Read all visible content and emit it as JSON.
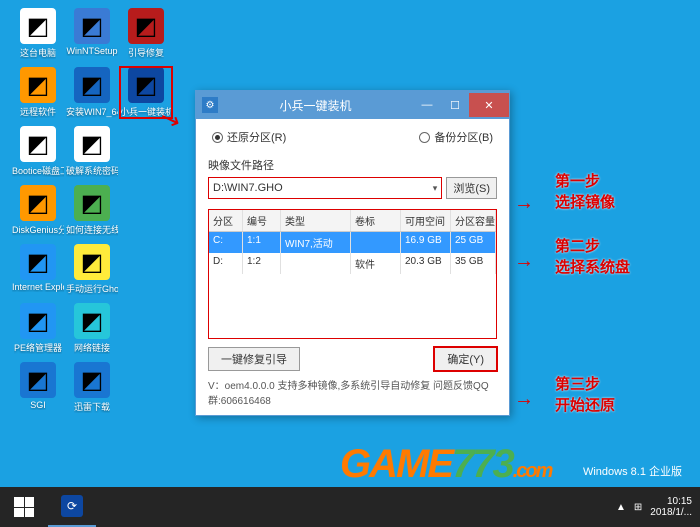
{
  "desktop": {
    "icons": [
      [
        {
          "label": "这台电脑",
          "name": "this-pc",
          "bg": "#fff"
        },
        {
          "label": "WinNTSetup",
          "name": "win-nt-setup",
          "bg": "#3a7bd5"
        },
        {
          "label": "引导修复",
          "name": "boot-repair",
          "bg": "#b71c1c"
        }
      ],
      [
        {
          "label": "远程软件",
          "name": "remote-software",
          "bg": "#ff9800"
        },
        {
          "label": "安装WIN7_64...",
          "name": "install-win7",
          "bg": "#1565c0"
        },
        {
          "label": "小兵一键装机",
          "name": "xiaobing-installer",
          "bg": "#0d47a1",
          "highlighted": true
        }
      ],
      [
        {
          "label": "Bootice磁盘工具",
          "name": "bootice",
          "bg": "#fff"
        },
        {
          "label": "破解系统密码",
          "name": "crack-password",
          "bg": "#fff"
        }
      ],
      [
        {
          "label": "DiskGenius分区工具",
          "name": "diskgenius",
          "bg": "#ff9800"
        },
        {
          "label": "如何连接无线网络",
          "name": "wifi-help",
          "bg": "#4caf50"
        }
      ],
      [
        {
          "label": "Internet Explorer",
          "name": "internet-explorer",
          "bg": "#2196f3"
        },
        {
          "label": "手动运行Ghost",
          "name": "ghost-manual",
          "bg": "#ffeb3b"
        }
      ],
      [
        {
          "label": "PE络管理器",
          "name": "pe-network",
          "bg": "#2196f3"
        },
        {
          "label": "网络链接",
          "name": "network-conn",
          "bg": "#26c6da"
        }
      ],
      [
        {
          "label": "SGI",
          "name": "sgi",
          "bg": "#1976d2"
        },
        {
          "label": "迅雷下载",
          "name": "xunlei",
          "bg": "#1976d2"
        }
      ]
    ]
  },
  "dialog": {
    "title": "小兵一键装机",
    "radio_restore": "还原分区(R)",
    "radio_backup": "备份分区(B)",
    "image_path_label": "映像文件路径",
    "image_path_value": "D:\\WIN7.GHO",
    "browse_btn": "浏览(S)",
    "columns": [
      "分区",
      "编号",
      "类型",
      "卷标",
      "可用空间",
      "分区容量"
    ],
    "rows": [
      {
        "part": "C:",
        "num": "1:1",
        "type": "WIN7,活动",
        "vol": "",
        "free": "16.9 GB",
        "size": "25 GB",
        "selected": true
      },
      {
        "part": "D:",
        "num": "1:2",
        "type": "",
        "vol": "软件",
        "free": "20.3 GB",
        "size": "35 GB",
        "selected": false
      }
    ],
    "repair_btn": "一键修复引导",
    "ok_btn": "确定(Y)",
    "footer": "V：oem4.0.0.0        支持多种镜像,多系统引导自动修复 问题反馈QQ群:606616468"
  },
  "annotations": {
    "step1_title": "第一步",
    "step1_sub": "选择镜像",
    "step2_title": "第二步",
    "step2_sub": "选择系统盘",
    "step3_title": "第三步",
    "step3_sub": "开始还原"
  },
  "taskbar": {
    "os_label": "Windows 8.1 企业版",
    "time": "10:15",
    "date": "2018/1/..."
  },
  "watermark": "GAME773.com"
}
